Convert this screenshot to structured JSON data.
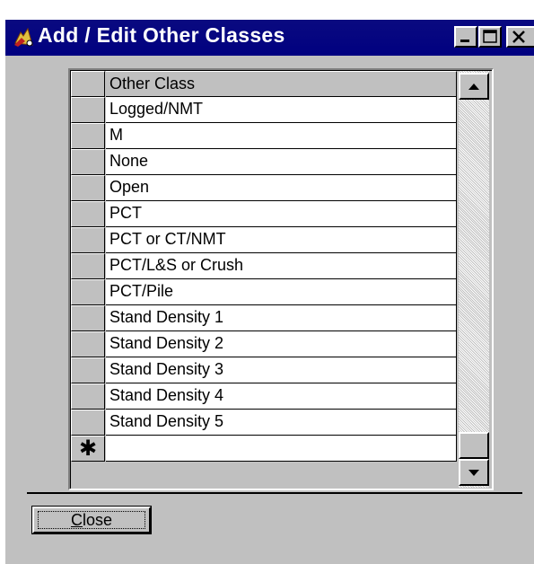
{
  "window": {
    "title": "Add / Edit Other Classes"
  },
  "titlebar_buttons": {
    "minimize_icon": "minimize-icon",
    "maximize_icon": "maximize-icon",
    "close_icon": "close-icon"
  },
  "grid": {
    "column_header": "Other Class",
    "rows": [
      "Logged/NMT",
      "M",
      "None",
      "Open",
      "PCT",
      "PCT or CT/NMT",
      "PCT/L&S or Crush",
      "PCT/Pile",
      "Stand Density 1",
      "Stand Density 2",
      "Stand Density 3",
      "Stand Density 4",
      "Stand Density 5"
    ],
    "new_row_marker": "✱"
  },
  "footer": {
    "close_label_mnemonic": "C",
    "close_label_rest": "lose"
  },
  "colors": {
    "titlebar": "#000080",
    "face": "#c0c0c0",
    "cell_bg": "#ffffff"
  }
}
